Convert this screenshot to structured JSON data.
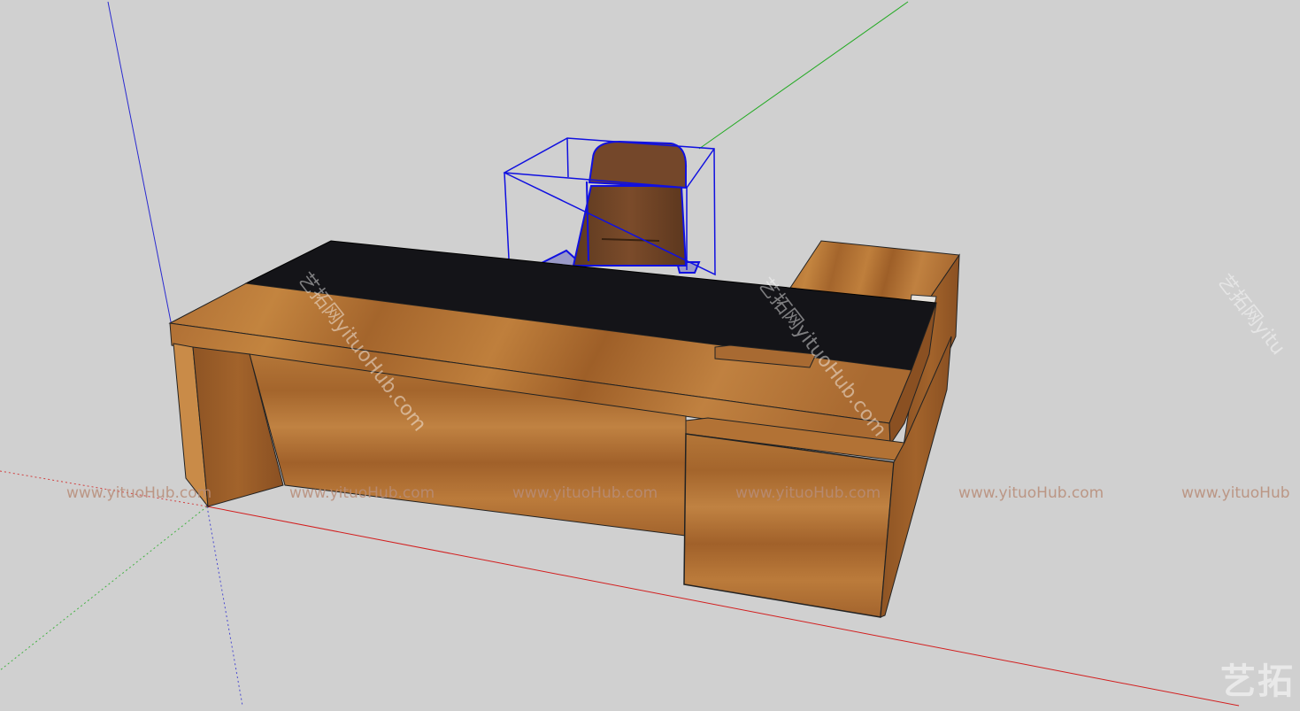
{
  "scene": {
    "background": "#d0d0d0",
    "axis_colors": {
      "red": "#d21e1e",
      "green": "#22aa22",
      "blue": "#2a2ad0"
    },
    "selection_color": "#1010e0",
    "model": {
      "name": "office-desk-with-chair",
      "wood_colors": [
        "#a9682d",
        "#b8793a",
        "#9a5a26",
        "#c58a46"
      ],
      "desktop_pad_color": "#141418",
      "chair_color": "#6f4325",
      "selected_object": "chair"
    }
  },
  "watermarks": {
    "horizontal": [
      "www.yituoHub.com",
      "www.yituoHub.com",
      "www.yituoHub.com",
      "www.yituoHub.com",
      "www.yituoHub.com",
      "www.yituoHub"
    ],
    "diagonal": [
      "艺拓网yituoHub.com",
      "艺拓网yituoHub.com",
      "艺拓网yitu"
    ],
    "logo": "艺拓"
  }
}
